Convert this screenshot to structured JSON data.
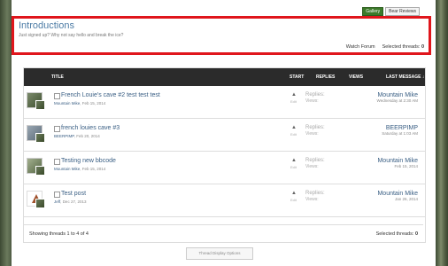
{
  "topbar": {
    "gallery": "Gallery",
    "bear_reviews": "Bear Reviews"
  },
  "intro": {
    "title": "Introductions",
    "description": "Just signed up? Why not say hello and break the ice?",
    "watch_forum": "Watch Forum",
    "selected_label": "Selected threads:",
    "selected_count": "0"
  },
  "table": {
    "headers": {
      "title": "TITLE",
      "start": "START",
      "replies": "REPLIES",
      "views": "VIEWS",
      "last": "LAST MESSAGE ↓"
    },
    "rows": [
      {
        "title": "French Louie's cave #2 test test test",
        "author": "Mountain Mike",
        "date": "Feb 15, 2014",
        "replies": "Replies:",
        "views": "Views:",
        "edit": "Edit",
        "last_name": "Mountain Mike",
        "last_date": "Wednesday at 2:30 AM"
      },
      {
        "title": "french louies cave #3",
        "author": "BEERPIMP",
        "date": "Feb 20, 2014",
        "replies": "Replies:",
        "views": "Views:",
        "edit": "Edit",
        "last_name": "BEERPIMP",
        "last_date": "Saturday at 1:03 AM"
      },
      {
        "title": "Testing new bbcode",
        "author": "Mountain Mike",
        "date": "Feb 15, 2014",
        "replies": "Replies:",
        "views": "Views:",
        "edit": "Edit",
        "last_name": "Mountain Mike",
        "last_date": "Feb 15, 2014"
      },
      {
        "title": "Test post",
        "author": "Jeff",
        "date": "Dec 27, 2013",
        "replies": "Replies:",
        "views": "Views:",
        "edit": "Edit",
        "last_name": "Mountain Mike",
        "last_date": "Jan 26, 2014"
      }
    ],
    "footer_left": "Showing threads 1 to 4 of 4",
    "footer_right_label": "Selected threads:",
    "footer_right_count": "0"
  },
  "thread_display_options": "Thread Display Options"
}
